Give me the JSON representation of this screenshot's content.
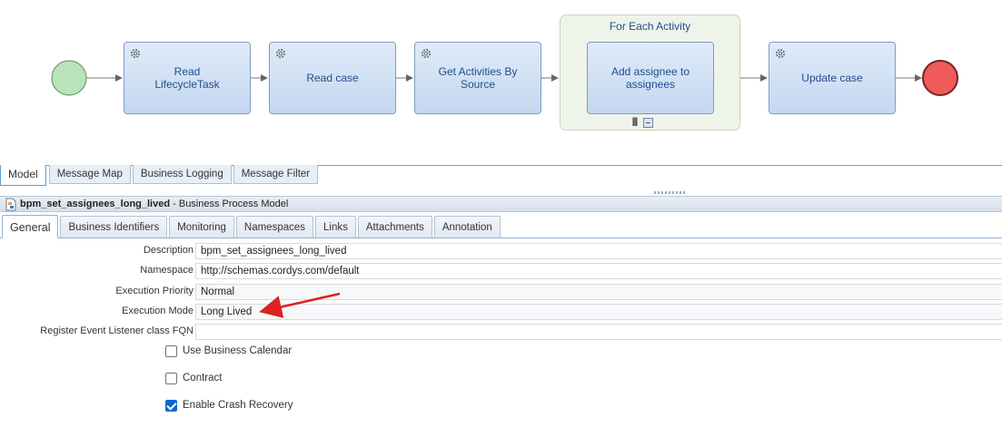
{
  "process_diagram": {
    "tasks": [
      {
        "id": "read-lifecycletask",
        "label": "Read\nLifecycleTask"
      },
      {
        "id": "read-case",
        "label": "Read case"
      },
      {
        "id": "get-activities-by-source",
        "label": "Get Activities By\nSource"
      },
      {
        "id": "add-assignee",
        "label": "Add assignee to\nassignees"
      },
      {
        "id": "update-case",
        "label": "Update case"
      }
    ],
    "loop_container": {
      "title": "For Each Activity"
    },
    "colors": {
      "start_event": "#b7e3b7",
      "end_event": "#ef5b5b",
      "task_border": "#7e9cc6",
      "task_text": "#1f4e8c"
    }
  },
  "editor_tabs": [
    {
      "label": "Model",
      "active": true
    },
    {
      "label": "Message Map"
    },
    {
      "label": "Business Logging"
    },
    {
      "label": "Message Filter"
    }
  ],
  "panel": {
    "process_name": "bpm_set_assignees_long_lived",
    "title_suffix": " - Business Process Model"
  },
  "property_tabs": [
    {
      "label": "General",
      "active": true
    },
    {
      "label": "Business Identifiers"
    },
    {
      "label": "Monitoring"
    },
    {
      "label": "Namespaces"
    },
    {
      "label": "Links"
    },
    {
      "label": "Attachments"
    },
    {
      "label": "Annotation"
    }
  ],
  "fields": {
    "description": {
      "label": "Description",
      "value": "bpm_set_assignees_long_lived"
    },
    "namespace": {
      "label": "Namespace",
      "value": "http://schemas.cordys.com/default"
    },
    "execution_priority": {
      "label": "Execution Priority",
      "value": "Normal"
    },
    "execution_mode": {
      "label": "Execution Mode",
      "value": "Long Lived"
    },
    "event_listener": {
      "label": "Register Event Listener class FQN",
      "value": ""
    }
  },
  "checkboxes": {
    "use_business_calendar": {
      "label": "Use Business Calendar",
      "checked": false
    },
    "contract": {
      "label": "Contract",
      "checked": false
    },
    "enable_crash_recovery": {
      "label": "Enable Crash Recovery",
      "checked": true
    }
  },
  "annotation_arrow_color": "#e02020"
}
